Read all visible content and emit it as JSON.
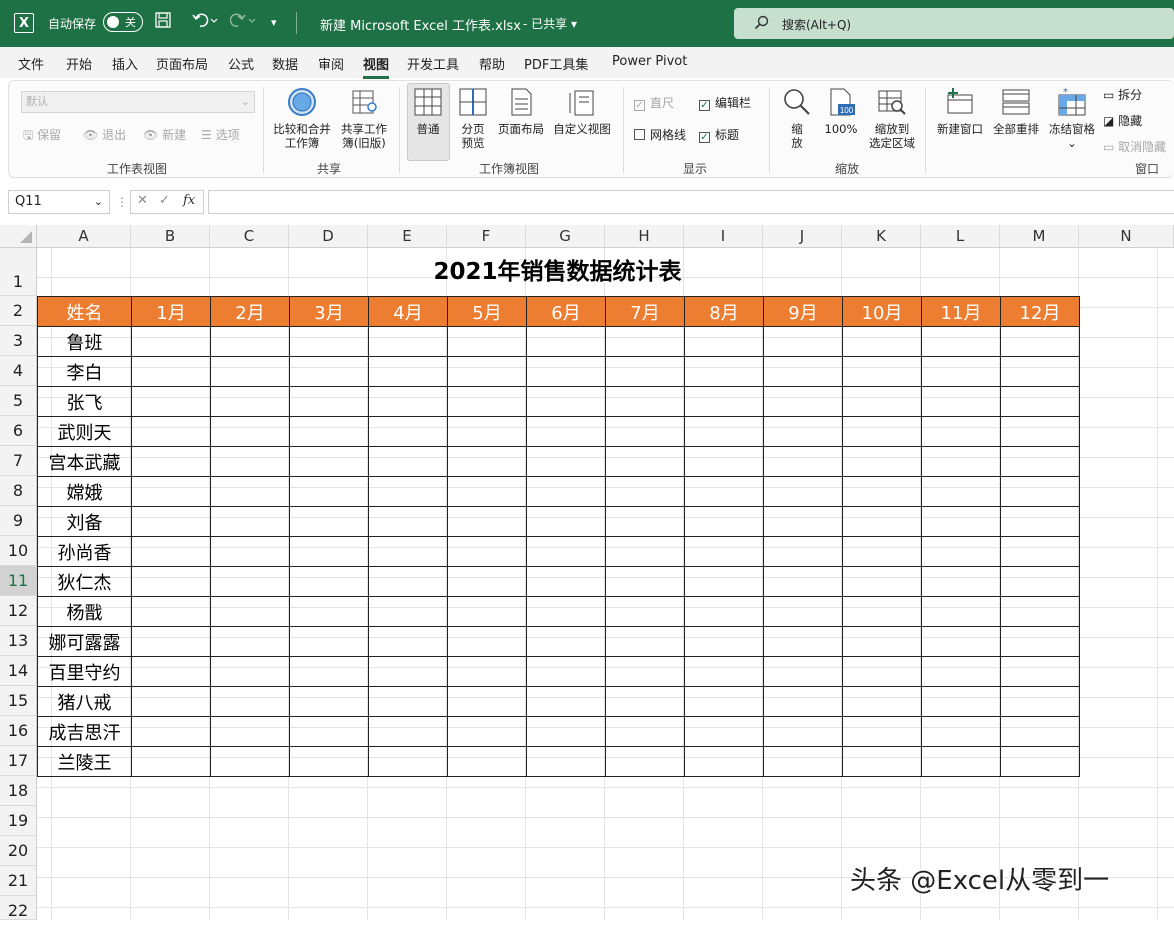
{
  "titlebar": {
    "autosave_label": "自动保存",
    "toggle_state": "关",
    "doc_title": "新建 Microsoft Excel 工作表.xlsx",
    "shared_label": "- 已共享 ▾",
    "search_placeholder": "搜索(Alt+Q)"
  },
  "tabs": [
    "文件",
    "开始",
    "插入",
    "页面布局",
    "公式",
    "数据",
    "审阅",
    "视图",
    "开发工具",
    "帮助",
    "PDF工具集",
    "Power Pivot"
  ],
  "active_tab": "视图",
  "ribbon": {
    "sheet_view": {
      "select_value": "默认",
      "keep": "保留",
      "exit": "退出",
      "new": "新建",
      "options": "选项",
      "label": "工作表视图"
    },
    "share": {
      "compare_line1": "比较和合并",
      "compare_line2": "工作簿",
      "share_line1": "共享工作",
      "share_line2": "簿(旧版)",
      "label": "共享"
    },
    "workbook_views": {
      "normal": "普通",
      "page_break_line1": "分页",
      "page_break_line2": "预览",
      "page_layout": "页面布局",
      "custom": "自定义视图",
      "label": "工作簿视图"
    },
    "show": {
      "ruler": "直尺",
      "formula_bar": "编辑栏",
      "gridlines": "网格线",
      "headings": "标题",
      "label": "显示"
    },
    "zoom": {
      "zoom_line1": "缩",
      "zoom_line2": "放",
      "hundred": "100%",
      "zoom_sel_line1": "缩放到",
      "zoom_sel_line2": "选定区域",
      "label": "缩放"
    },
    "window": {
      "new_window": "新建窗口",
      "arrange_all": "全部重排",
      "freeze_panes": "冻结窗格",
      "split": "拆分",
      "hide": "隐藏",
      "unhide": "取消隐藏",
      "label": "窗口"
    }
  },
  "formula_bar": {
    "name_box": "Q11",
    "fx": "fx",
    "formula": ""
  },
  "columns": [
    "A",
    "B",
    "C",
    "D",
    "E",
    "F",
    "G",
    "H",
    "I",
    "J",
    "K",
    "L",
    "M",
    "N"
  ],
  "rows": [
    "1",
    "2",
    "3",
    "4",
    "5",
    "6",
    "7",
    "8",
    "9",
    "10",
    "11",
    "12",
    "13",
    "14",
    "15",
    "16",
    "17",
    "18",
    "19",
    "20",
    "21",
    "22"
  ],
  "selected_row": "11",
  "sheet": {
    "title": "2021年销售数据统计表",
    "header": [
      "姓名",
      "1月",
      "2月",
      "3月",
      "4月",
      "5月",
      "6月",
      "7月",
      "8月",
      "9月",
      "10月",
      "11月",
      "12月"
    ],
    "names": [
      "鲁班",
      "李白",
      "张飞",
      "武则天",
      "宫本武藏",
      "嫦娥",
      "刘备",
      "孙尚香",
      "狄仁杰",
      "杨戬",
      "娜可露露",
      "百里守约",
      "猪八戒",
      "成吉思汗",
      "兰陵王"
    ]
  },
  "watermark": "头条 @Excel从零到一",
  "colors": {
    "excel_green": "#1e7145",
    "header_orange": "#ed7d31"
  }
}
